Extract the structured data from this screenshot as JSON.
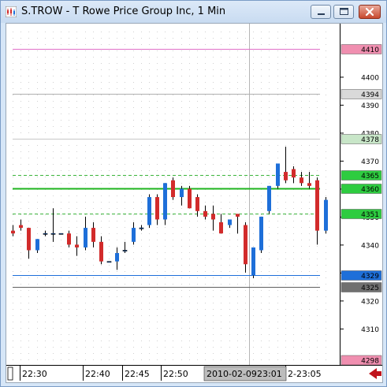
{
  "window": {
    "title": "S.TROW - T Rowe Price Group Inc, 1 Min",
    "buttons": [
      "minimize",
      "maximize",
      "close"
    ]
  },
  "colors": {
    "up_candle": "#1e6fd9",
    "down_candle": "#d22b2b",
    "grid": "#c8c8c8",
    "crosshair": "#b4b4b4"
  },
  "price_axis": {
    "labels": [
      "4400",
      "4390",
      "4380",
      "4370",
      "4360",
      "4350",
      "4340",
      "4330",
      "4320",
      "4310"
    ]
  },
  "time_axis": {
    "labels": [
      "22:30",
      "22:40",
      "22:45",
      "22:50",
      "23:01",
      "2-23:05"
    ],
    "cursor_date": "2010-02-09"
  },
  "levels": [
    {
      "price": 4410,
      "label": "4410",
      "line_color": "#e070c8",
      "tag_color": "#f08fb0",
      "text_color": "#000",
      "dashed": false
    },
    {
      "price": 4394,
      "label": "4394",
      "line_color": "#b0b0b0",
      "tag_color": "#d9d9d9",
      "text_color": "#000",
      "dashed": false
    },
    {
      "price": 4378,
      "label": "4378",
      "line_color": "#c8c8c8",
      "tag_color": "#c8e6c8",
      "text_color": "#000",
      "dashed": false
    },
    {
      "price": 4365,
      "label": "4365",
      "line_color": "#3cb43c",
      "tag_color": "#2ecc40",
      "text_color": "#000",
      "dashed": true
    },
    {
      "price": 4360,
      "label": "4360",
      "line_color": "#1fb41f",
      "tag_color": "#2ecc40",
      "text_color": "#000",
      "dashed": false
    },
    {
      "price": 4351,
      "label": "4351",
      "line_color": "#3cb43c",
      "tag_color": "#2ecc40",
      "text_color": "#000",
      "dashed": true
    },
    {
      "price": 4329,
      "label": "4329",
      "line_color": "#1e6fd9",
      "tag_color": "#1e6fd9",
      "text_color": "#fff",
      "dashed": false
    },
    {
      "price": 4325,
      "label": "4325",
      "line_color": "#606060",
      "tag_color": "#707070",
      "text_color": "#000",
      "dashed": false
    },
    {
      "price": 4298,
      "label": "4298",
      "line_color": "#e070c8",
      "tag_color": "#f08fb0",
      "text_color": "#000",
      "dashed": false
    }
  ],
  "chart_data": {
    "type": "candlestick",
    "title": "S.TROW - T Rowe Price Group Inc, 1 Min",
    "ylim": [
      4297,
      4419
    ],
    "candles": [
      {
        "o": 4345,
        "h": 4347,
        "l": 4343,
        "c": 4344
      },
      {
        "o": 4347,
        "h": 4349,
        "l": 4345,
        "c": 4346
      },
      {
        "o": 4346,
        "h": 4346,
        "l": 4335,
        "c": 4338
      },
      {
        "o": 4338,
        "h": 4342,
        "l": 4337,
        "c": 4342
      },
      {
        "o": 4344,
        "h": 4345,
        "l": 4343,
        "c": 4344
      },
      {
        "o": 4344,
        "h": 4353,
        "l": 4341,
        "c": 4344
      },
      {
        "o": 4344,
        "h": 4344,
        "l": 4344,
        "c": 4344
      },
      {
        "o": 4344,
        "h": 4345,
        "l": 4339,
        "c": 4340
      },
      {
        "o": 4340,
        "h": 4343,
        "l": 4336,
        "c": 4339
      },
      {
        "o": 4339,
        "h": 4350,
        "l": 4338,
        "c": 4346
      },
      {
        "o": 4346,
        "h": 4348,
        "l": 4339,
        "c": 4341
      },
      {
        "o": 4341,
        "h": 4343,
        "l": 4333,
        "c": 4334
      },
      {
        "o": 4334,
        "h": 4334,
        "l": 4334,
        "c": 4334
      },
      {
        "o": 4334,
        "h": 4339,
        "l": 4331,
        "c": 4337
      },
      {
        "o": 4338,
        "h": 4341,
        "l": 4337,
        "c": 4338
      },
      {
        "o": 4341,
        "h": 4348,
        "l": 4340,
        "c": 4346
      },
      {
        "o": 4346,
        "h": 4347,
        "l": 4345,
        "c": 4346
      },
      {
        "o": 4347,
        "h": 4358,
        "l": 4346,
        "c": 4357
      },
      {
        "o": 4357,
        "h": 4358,
        "l": 4347,
        "c": 4349
      },
      {
        "o": 4349,
        "h": 4362,
        "l": 4347,
        "c": 4362
      },
      {
        "o": 4363,
        "h": 4364,
        "l": 4356,
        "c": 4357
      },
      {
        "o": 4357,
        "h": 4361,
        "l": 4354,
        "c": 4360
      },
      {
        "o": 4360,
        "h": 4361,
        "l": 4353,
        "c": 4353
      },
      {
        "o": 4357,
        "h": 4358,
        "l": 4350,
        "c": 4352
      },
      {
        "o": 4352,
        "h": 4354,
        "l": 4349,
        "c": 4350
      },
      {
        "o": 4351,
        "h": 4354,
        "l": 4345,
        "c": 4349
      },
      {
        "o": 4348,
        "h": 4351,
        "l": 4344,
        "c": 4344
      },
      {
        "o": 4347,
        "h": 4349,
        "l": 4346,
        "c": 4349
      },
      {
        "o": 4351,
        "h": 4351,
        "l": 4344,
        "c": 4350
      },
      {
        "o": 4347,
        "h": 4348,
        "l": 4330,
        "c": 4333
      },
      {
        "o": 4329,
        "h": 4339,
        "l": 4328,
        "c": 4339
      },
      {
        "o": 4338,
        "h": 4350,
        "l": 4337,
        "c": 4350
      },
      {
        "o": 4352,
        "h": 4361,
        "l": 4351,
        "c": 4361
      },
      {
        "o": 4361,
        "h": 4369,
        "l": 4360,
        "c": 4369
      },
      {
        "o": 4366,
        "h": 4375,
        "l": 4362,
        "c": 4363
      },
      {
        "o": 4367,
        "h": 4368,
        "l": 4362,
        "c": 4364
      },
      {
        "o": 4364,
        "h": 4366,
        "l": 4361,
        "c": 4362
      },
      {
        "o": 4362,
        "h": 4366,
        "l": 4360,
        "c": 4361
      },
      {
        "o": 4363,
        "h": 4364,
        "l": 4340,
        "c": 4345
      },
      {
        "o": 4345,
        "h": 4357,
        "l": 4344,
        "c": 4356
      }
    ]
  }
}
